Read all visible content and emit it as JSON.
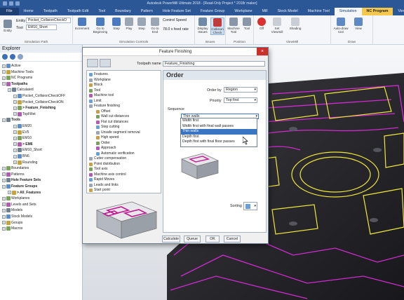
{
  "window": {
    "title": "Autodesk PowerMill Ultimate 2018 - [Read-Only Project * 2018r maker]"
  },
  "tabs": [
    "File",
    "Home",
    "Toolpath",
    "Toolpath Edit",
    "Tool",
    "Boundary",
    "Pattern",
    "Hole Feature Set",
    "Feature Group",
    "Workplane",
    "Mill",
    "Stock Model",
    "Machine Tool",
    "Simulation",
    "NC Program",
    "View"
  ],
  "ribbon": {
    "entity_label": "Entity",
    "entity_value": "Pocket_CollisionCheckO",
    "tool_label": "Tool",
    "tool_value": "EM10_Short",
    "sim_path_group": "Simulation Path",
    "increment": "Increment",
    "go_to_beginning": "Go to Beginning",
    "step": "Step",
    "play": "Play",
    "step_forward": "Step",
    "go_to_end": "Go to End",
    "speed_label": "Control Speed",
    "feed_rate": "78.0 x feed rate",
    "sim_controls_group": "Simulation Controls",
    "display_issues": "Display Issues",
    "collision_check": "Collision Check",
    "issues_group": "Issues",
    "machine_tool": "Machine Tool",
    "tool_btn": "Tool",
    "position_group": "Position",
    "off": "Off",
    "set_viewmill": "Set Viewmill",
    "shading": "Shading",
    "viewmill_group": "ViewMill",
    "auto_draw": "Auto-draw tool",
    "view": "View",
    "draw_group": "Draw",
    "nc_program": "NC Program"
  },
  "explorer": {
    "title": "Explorer",
    "items": [
      {
        "label": "Active",
        "indent": 0
      },
      {
        "label": "Machine Tools",
        "indent": 0
      },
      {
        "label": "NC Programs",
        "indent": 0
      },
      {
        "label": "Toolpaths",
        "indent": 0,
        "bold": true
      },
      {
        "label": "Calculated",
        "indent": 1
      },
      {
        "label": "Pocket_CollisionCheckOFF",
        "indent": 2
      },
      {
        "label": "Pocket_CollisionCheckON",
        "indent": 2
      },
      {
        "label": "> Feature_Finishing",
        "indent": 2,
        "bold": true
      },
      {
        "label": "TopFillet",
        "indent": 2
      },
      {
        "label": "Tools",
        "indent": 0,
        "bold": true
      },
      {
        "label": "EM20",
        "indent": 2
      },
      {
        "label": "EV5",
        "indent": 2
      },
      {
        "label": "EM10",
        "indent": 2
      },
      {
        "label": "> EM6",
        "indent": 2,
        "bold": true
      },
      {
        "label": "EM10_Short",
        "indent": 2
      },
      {
        "label": "BN6",
        "indent": 2
      },
      {
        "label": "Rounding",
        "indent": 2
      },
      {
        "label": "Boundaries",
        "indent": 0
      },
      {
        "label": "Patterns",
        "indent": 0
      },
      {
        "label": "Hole Feature Sets",
        "indent": 0,
        "bold": true
      },
      {
        "label": "Feature Groups",
        "indent": 0,
        "bold": true
      },
      {
        "label": "> All_Features",
        "indent": 1,
        "bold": true
      },
      {
        "label": "Workplanes",
        "indent": 0
      },
      {
        "label": "Levels and Sets",
        "indent": 0
      },
      {
        "label": "Models",
        "indent": 0
      },
      {
        "label": "Stock Models",
        "indent": 0
      },
      {
        "label": "Groups",
        "indent": 0
      },
      {
        "label": "Macros",
        "indent": 0
      }
    ]
  },
  "dialog": {
    "title": "Feature Finishing",
    "toolpath_name_label": "Toolpath name",
    "toolpath_name_value": "Feature_Finishing",
    "nav": [
      {
        "label": "Features",
        "indent": 0
      },
      {
        "label": "Workplane",
        "indent": 0
      },
      {
        "label": "Block",
        "indent": 0
      },
      {
        "label": "Tool",
        "indent": 0
      },
      {
        "label": "Machine tool",
        "indent": 0
      },
      {
        "label": "Limit",
        "indent": 0
      },
      {
        "label": "Feature finishing",
        "indent": 0
      },
      {
        "label": "Offset",
        "indent": 1
      },
      {
        "label": "Wall cut distances",
        "indent": 1
      },
      {
        "label": "Flat cut distances",
        "indent": 1
      },
      {
        "label": "Step cutting",
        "indent": 1
      },
      {
        "label": "Unsafe segment removal",
        "indent": 1
      },
      {
        "label": "High speed",
        "indent": 1
      },
      {
        "label": "Order",
        "indent": 1
      },
      {
        "label": "Approach",
        "indent": 1
      },
      {
        "label": "Automatic verification",
        "indent": 1
      },
      {
        "label": "Cutter compensation",
        "indent": 0
      },
      {
        "label": "Point distribution",
        "indent": 0
      },
      {
        "label": "Tool axis",
        "indent": 0
      },
      {
        "label": "Machine axis control",
        "indent": 0
      },
      {
        "label": "Rapid Moves",
        "indent": 0
      },
      {
        "label": "Leads and links",
        "indent": 0
      },
      {
        "label": "Start point",
        "indent": 0
      }
    ],
    "panel_title": "Order",
    "order_by_label": "Order by",
    "order_by_value": "Region",
    "priority_label": "Priority",
    "priority_value": "Top first",
    "sequence_label": "Sequence",
    "sequence_value": "Thin walls",
    "sequence_options": [
      "Width first",
      "Width first with final wall passes",
      "Thin walls",
      "Depth first",
      "Depth first with final floor passes"
    ],
    "sequence_selected_index": 2,
    "sorting_label": "Sorting",
    "buttons": {
      "calculate": "Calculate",
      "queue": "Queue",
      "ok": "OK",
      "cancel": "Cancel"
    },
    "close_glyph": "×"
  },
  "icons": {
    "close": "close-icon"
  },
  "colors": {
    "ribbon_blue": "#2b5797",
    "nc_tab": "#f3c84c",
    "toolpath_magenta": "#d12bd1",
    "selection_yellow": "#f0e83a",
    "highlight": "#3a75c4"
  }
}
